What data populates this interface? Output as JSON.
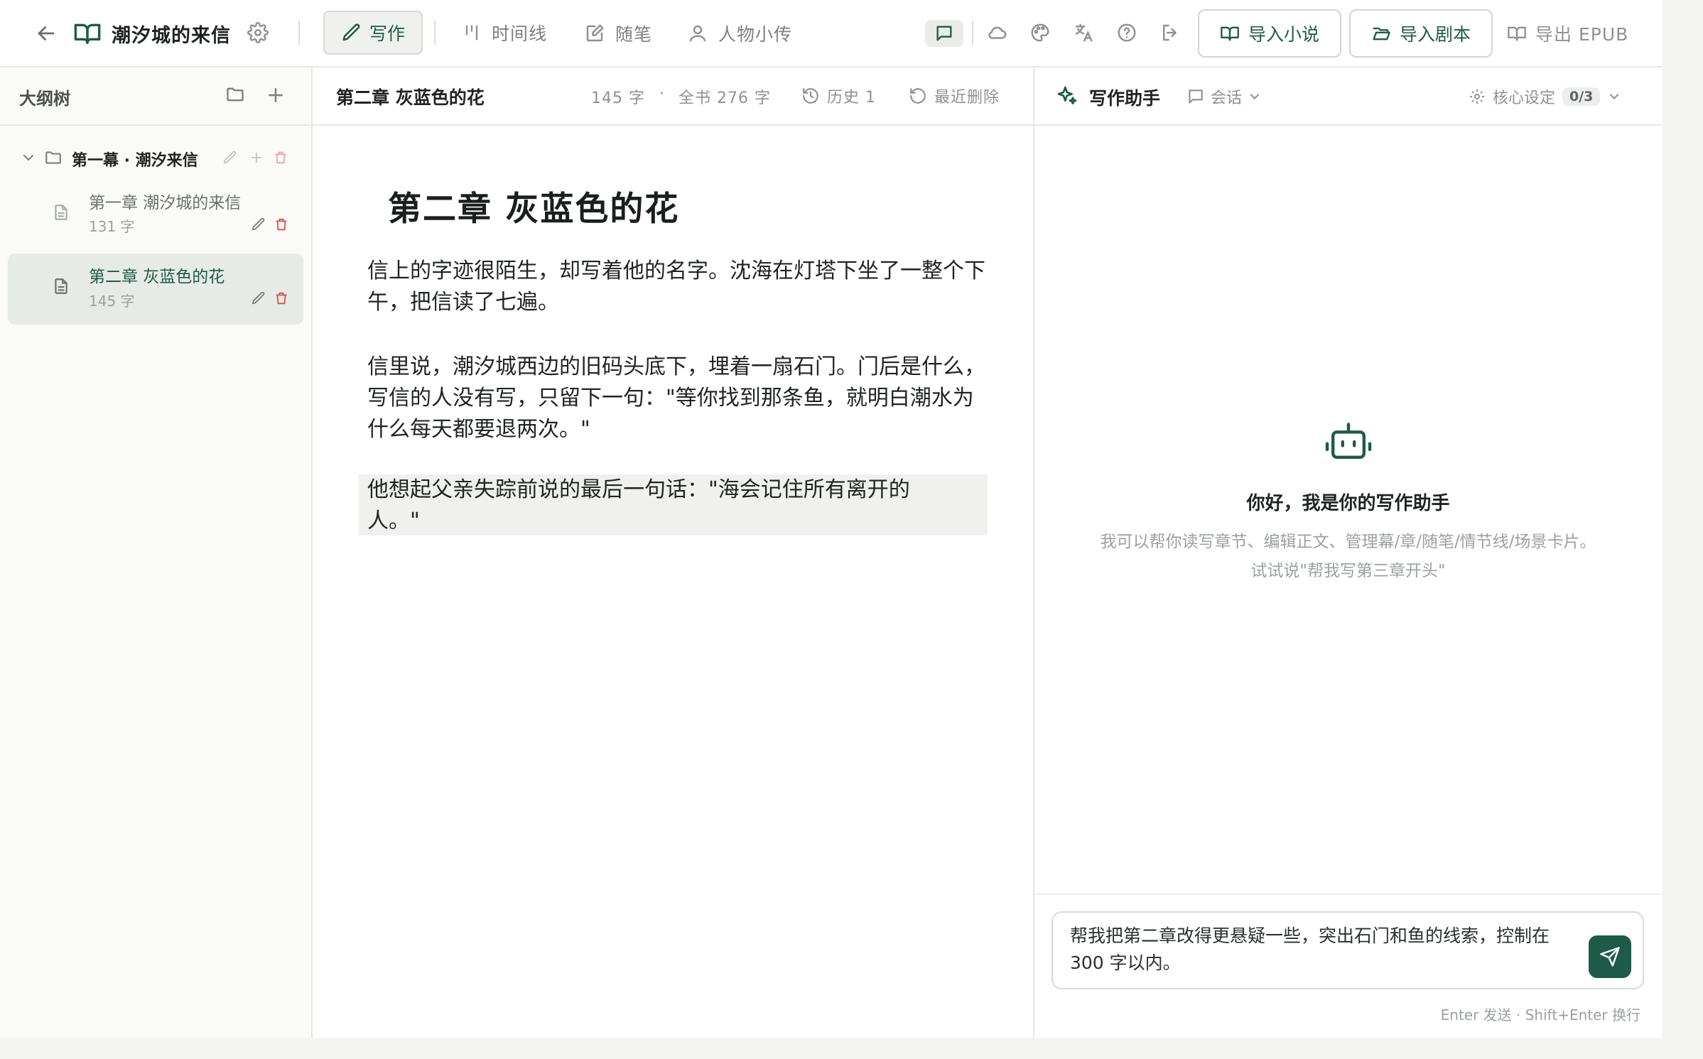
{
  "colors": {
    "accent": "#1e5a48",
    "danger": "#d9534f",
    "muted": "#8d938f"
  },
  "header": {
    "title": "潮汐城的来信",
    "nav": {
      "write": "写作",
      "timeline": "时间线",
      "notes": "随笔",
      "characters": "人物小传"
    },
    "import_novel": "导入小说",
    "import_script": "导入剧本",
    "export_epub": "导出 EPUB"
  },
  "sidebar": {
    "title": "大纲树",
    "act": {
      "label": "第一幕 · 潮汐来信"
    },
    "chapters": [
      {
        "title": "第一章 潮汐城的来信",
        "count": "131 字"
      },
      {
        "title": "第二章 灰蓝色的花",
        "count": "145 字",
        "active": true
      }
    ]
  },
  "editor": {
    "chapter_label": "第二章 灰蓝色的花",
    "word_count": "145 字",
    "dot": "·",
    "book_count": "全书 276 字",
    "history": "历史 1",
    "recent_deleted": "最近删除",
    "doc_title": "第二章  灰蓝色的花",
    "paragraphs": [
      "信上的字迹很陌生，却写着他的名字。沈海在灯塔下坐了一整个下午，把信读了七遍。",
      "信里说，潮汐城西边的旧码头底下，埋着一扇石门。门后是什么，写信的人没有写，只留下一句：\"等你找到那条鱼，就明白潮水为什么每天都要退两次。\"",
      "他想起父亲失踪前说的最后一句话：\"海会记住所有离开的人。\""
    ]
  },
  "assistant": {
    "title": "写作助手",
    "session": "会话",
    "core_settings": "核心设定",
    "core_count": "0/3",
    "welcome_title": "你好，我是你的写作助手",
    "welcome_line1": "我可以帮你读写章节、编辑正文、管理幕/章/随笔/情节线/场景卡片。",
    "welcome_line2": "试试说\"帮我写第三章开头\"",
    "input_value": "帮我把第二章改得更悬疑一些，突出石门和鱼的线索，控制在 300 字以内。",
    "hint": "Enter 发送 · Shift+Enter 换行"
  }
}
